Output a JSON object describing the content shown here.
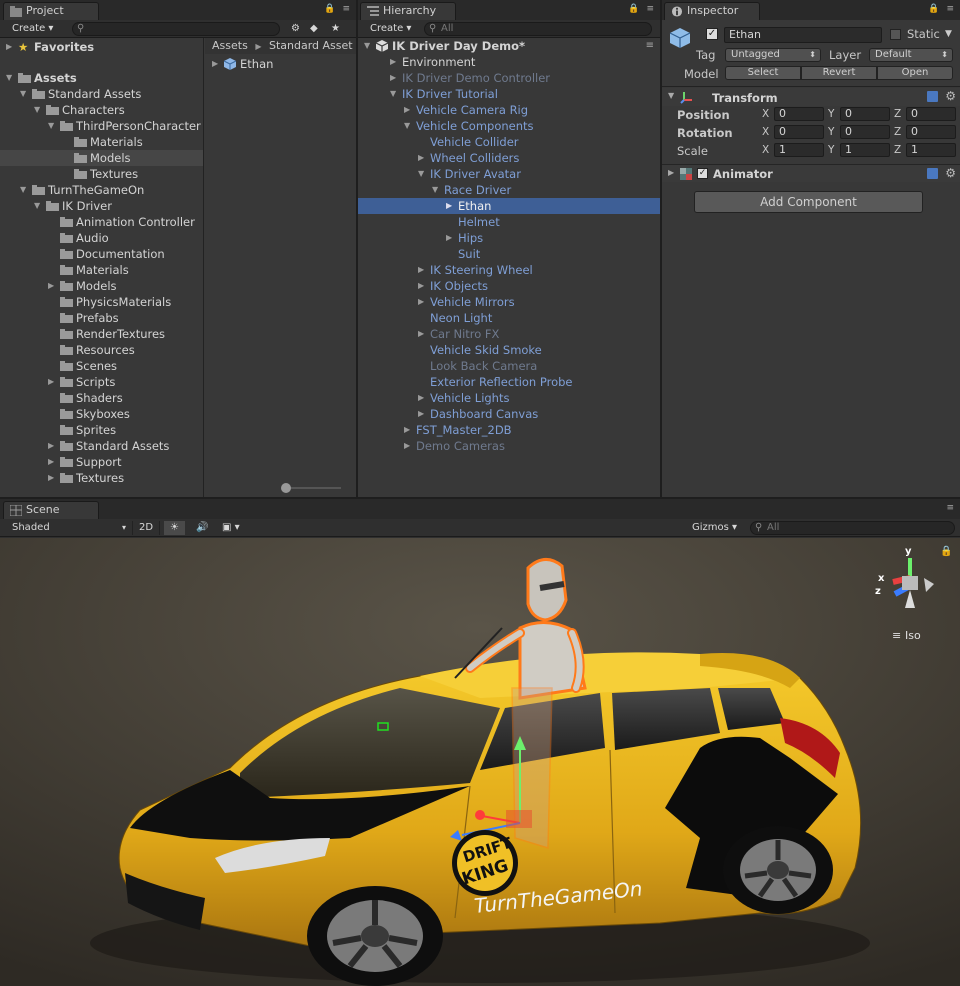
{
  "project": {
    "tab": "Project",
    "create": "Create",
    "breadcrumb": [
      "Assets",
      "Standard Asset"
    ],
    "favorites": "Favorites",
    "tree": [
      {
        "label": "Assets",
        "depth": 0,
        "arrow": "down",
        "bold": true
      },
      {
        "label": "Standard Assets",
        "depth": 1,
        "arrow": "down"
      },
      {
        "label": "Characters",
        "depth": 2,
        "arrow": "down"
      },
      {
        "label": "ThirdPersonCharacter",
        "depth": 3,
        "arrow": "down"
      },
      {
        "label": "Materials",
        "depth": 4,
        "arrow": "none"
      },
      {
        "label": "Models",
        "depth": 4,
        "arrow": "none",
        "highlight": true
      },
      {
        "label": "Textures",
        "depth": 4,
        "arrow": "none"
      },
      {
        "label": "TurnTheGameOn",
        "depth": 1,
        "arrow": "down"
      },
      {
        "label": "IK Driver",
        "depth": 2,
        "arrow": "down"
      },
      {
        "label": "Animation Controller",
        "depth": 3,
        "arrow": "none"
      },
      {
        "label": "Audio",
        "depth": 3,
        "arrow": "none"
      },
      {
        "label": "Documentation",
        "depth": 3,
        "arrow": "none"
      },
      {
        "label": "Materials",
        "depth": 3,
        "arrow": "none"
      },
      {
        "label": "Models",
        "depth": 3,
        "arrow": "right"
      },
      {
        "label": "PhysicsMaterials",
        "depth": 3,
        "arrow": "none"
      },
      {
        "label": "Prefabs",
        "depth": 3,
        "arrow": "none"
      },
      {
        "label": "RenderTextures",
        "depth": 3,
        "arrow": "none"
      },
      {
        "label": "Resources",
        "depth": 3,
        "arrow": "none"
      },
      {
        "label": "Scenes",
        "depth": 3,
        "arrow": "none"
      },
      {
        "label": "Scripts",
        "depth": 3,
        "arrow": "right"
      },
      {
        "label": "Shaders",
        "depth": 3,
        "arrow": "none"
      },
      {
        "label": "Skyboxes",
        "depth": 3,
        "arrow": "none"
      },
      {
        "label": "Sprites",
        "depth": 3,
        "arrow": "none"
      },
      {
        "label": "Standard Assets",
        "depth": 3,
        "arrow": "right"
      },
      {
        "label": "Support",
        "depth": 3,
        "arrow": "right"
      },
      {
        "label": "Textures",
        "depth": 3,
        "arrow": "right"
      }
    ],
    "asset_item": "Ethan"
  },
  "hierarchy": {
    "tab": "Hierarchy",
    "create": "Create",
    "search_placeholder": "All",
    "scene": "IK Driver Day Demo*",
    "items": [
      {
        "label": "Environment",
        "depth": 1,
        "arrow": "right",
        "color": "white"
      },
      {
        "label": "IK Driver Demo Controller",
        "depth": 1,
        "arrow": "right",
        "color": "gray"
      },
      {
        "label": "IK Driver Tutorial",
        "depth": 1,
        "arrow": "down",
        "color": "blue"
      },
      {
        "label": "Vehicle Camera Rig",
        "depth": 2,
        "arrow": "right",
        "color": "blue"
      },
      {
        "label": "Vehicle Components",
        "depth": 2,
        "arrow": "down",
        "color": "blue"
      },
      {
        "label": "Vehicle Collider",
        "depth": 3,
        "arrow": "none",
        "color": "blue"
      },
      {
        "label": "Wheel Colliders",
        "depth": 3,
        "arrow": "right",
        "color": "blue"
      },
      {
        "label": "IK Driver Avatar",
        "depth": 3,
        "arrow": "down",
        "color": "blue"
      },
      {
        "label": "Race Driver",
        "depth": 4,
        "arrow": "down",
        "color": "blue"
      },
      {
        "label": "Ethan",
        "depth": 5,
        "arrow": "right",
        "color": "white",
        "selected": true
      },
      {
        "label": "Helmet",
        "depth": 5,
        "arrow": "none",
        "color": "blue"
      },
      {
        "label": "Hips",
        "depth": 5,
        "arrow": "right",
        "color": "blue"
      },
      {
        "label": "Suit",
        "depth": 5,
        "arrow": "none",
        "color": "blue"
      },
      {
        "label": "IK Steering Wheel",
        "depth": 3,
        "arrow": "right",
        "color": "blue"
      },
      {
        "label": "IK Objects",
        "depth": 3,
        "arrow": "right",
        "color": "blue"
      },
      {
        "label": "Vehicle Mirrors",
        "depth": 3,
        "arrow": "right",
        "color": "blue"
      },
      {
        "label": "Neon Light",
        "depth": 3,
        "arrow": "none",
        "color": "blue"
      },
      {
        "label": "Car Nitro FX",
        "depth": 3,
        "arrow": "right",
        "color": "gray"
      },
      {
        "label": "Vehicle Skid Smoke",
        "depth": 3,
        "arrow": "none",
        "color": "blue"
      },
      {
        "label": "Look Back Camera",
        "depth": 3,
        "arrow": "none",
        "color": "gray"
      },
      {
        "label": "Exterior Reflection Probe",
        "depth": 3,
        "arrow": "none",
        "color": "blue"
      },
      {
        "label": "Vehicle Lights",
        "depth": 3,
        "arrow": "right",
        "color": "blue"
      },
      {
        "label": "Dashboard Canvas",
        "depth": 3,
        "arrow": "right",
        "color": "blue"
      },
      {
        "label": "FST_Master_2DB",
        "depth": 2,
        "arrow": "right",
        "color": "blue"
      },
      {
        "label": "Demo Cameras",
        "depth": 2,
        "arrow": "right",
        "color": "gray"
      }
    ]
  },
  "inspector": {
    "tab": "Inspector",
    "name": "Ethan",
    "static": "Static",
    "tag_label": "Tag",
    "tag_value": "Untagged",
    "layer_label": "Layer",
    "layer_value": "Default",
    "model_label": "Model",
    "select": "Select",
    "revert": "Revert",
    "open": "Open",
    "transform": "Transform",
    "position": "Position",
    "rotation": "Rotation",
    "scale": "Scale",
    "pos": {
      "x": "0",
      "y": "0",
      "z": "0"
    },
    "rot": {
      "x": "0",
      "y": "0",
      "z": "0"
    },
    "scl": {
      "x": "1",
      "y": "1",
      "z": "1"
    },
    "ax_x": "X",
    "ax_y": "Y",
    "ax_z": "Z",
    "animator": "Animator",
    "add_component": "Add Component"
  },
  "scene": {
    "tab": "Scene",
    "shading": "Shaded",
    "mode2d": "2D",
    "gizmos": "Gizmos",
    "search_placeholder": "All",
    "iso": "Iso",
    "gizmo_y": "y",
    "gizmo_x": "x",
    "gizmo_z": "z",
    "car_brand": "TurnTheGameOn",
    "decal_1": "DRIFT",
    "decal_2": "KING"
  }
}
